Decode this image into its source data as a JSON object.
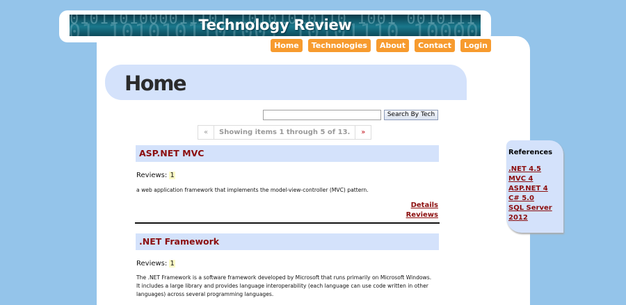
{
  "header": {
    "title": "Technology Review",
    "banner_bits_row1": "0101101000011101 10101010110 1001 0010111",
    "banner_bits_row2": "1101 1010101101001 10101110 1000010"
  },
  "nav": {
    "items": [
      {
        "label": "Home"
      },
      {
        "label": "Technologies"
      },
      {
        "label": "About"
      },
      {
        "label": "Contact"
      },
      {
        "label": "Login"
      }
    ]
  },
  "main": {
    "page_title": "Home",
    "search": {
      "value": "",
      "button_label": "Search By Tech"
    },
    "pager": {
      "prev": "«",
      "info": "Showing items 1 through 5 of 13.",
      "next": "»"
    },
    "items": [
      {
        "title": "ASP.NET MVC",
        "reviews_label": "Reviews:",
        "reviews_count": "1",
        "description": "a web application framework that implements the model-view-controller (MVC) pattern.",
        "details_link": "Details",
        "reviews_link": "Reviews"
      },
      {
        "title": ".NET Framework",
        "reviews_label": "Reviews:",
        "reviews_count": "1",
        "description": "The .NET Framework is a software framework developed by Microsoft that runs primarily on Microsoft Windows. It includes a large library and provides language interoperability (each language can use code written in other languages) across several programming languages."
      }
    ]
  },
  "sidebar": {
    "title": "References",
    "links": [
      {
        "label": ".NET 4.5"
      },
      {
        "label": "MVC 4"
      },
      {
        "label": "ASP.NET 4"
      },
      {
        "label": "C# 5.0"
      },
      {
        "label": "SQL Server 2012"
      }
    ]
  },
  "colors": {
    "background": "#94c4ea",
    "nav_button": "#f79b2e",
    "header_band": "#d4e2fb",
    "link": "#8b0d0d"
  }
}
